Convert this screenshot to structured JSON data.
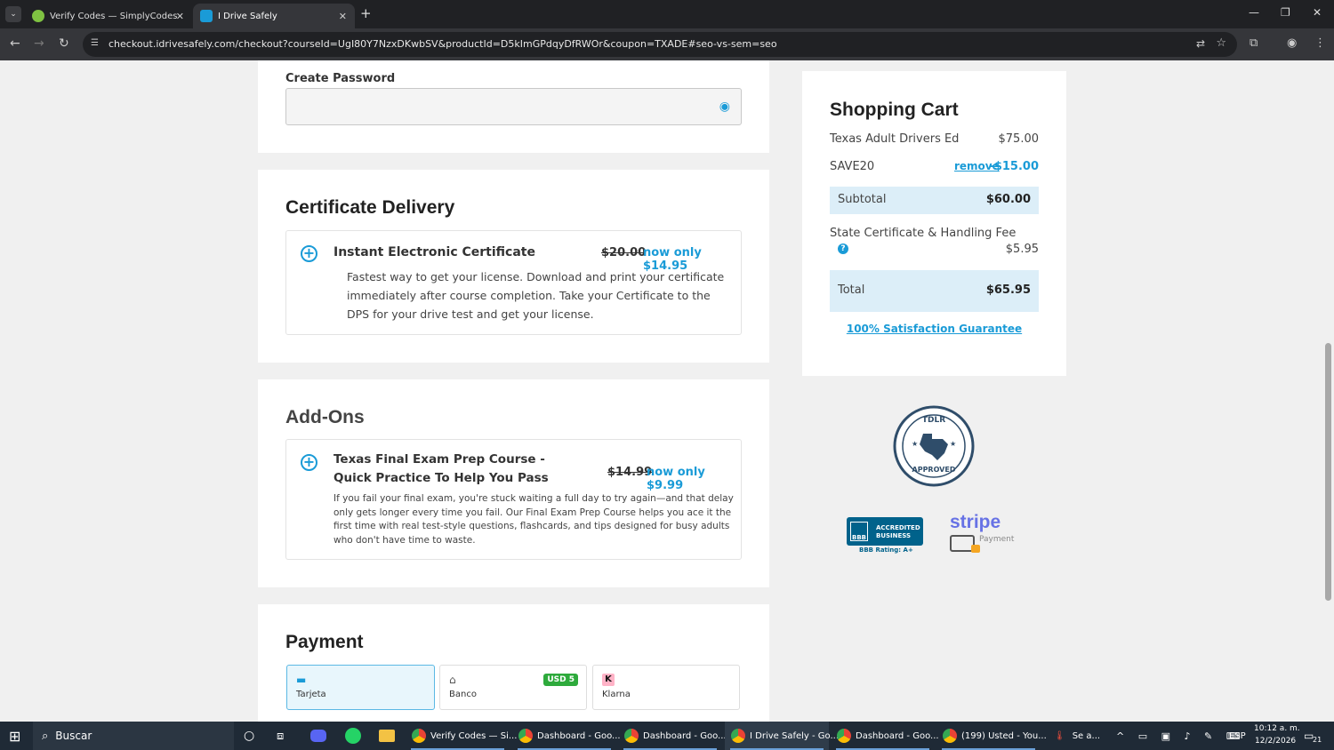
{
  "browser": {
    "tabs": [
      {
        "title": "Verify Codes — SimplyCodes",
        "icon": "check-circle-icon",
        "active": false
      },
      {
        "title": "I Drive Safely",
        "icon": "idrivesafely-icon",
        "active": true
      }
    ],
    "url": "checkout.idrivesafely.com/checkout?courseId=UgI80Y7NzxDKwbSV&productId=D5kImGPdqyDfRWOr&coupon=TXADE#seo-vs-sem=seo"
  },
  "account": {
    "password_label": "Create Password",
    "password_value": ""
  },
  "certificate": {
    "heading": "Certificate Delivery",
    "option_title": "Instant Electronic Certificate",
    "old_price": "$20.00",
    "now_price": "now only $14.95",
    "description": "Fastest way to get your license. Download and print your certificate immediately after course completion. Take your Certificate to the DPS for your drive test and get your license."
  },
  "addons": {
    "heading": "Add-Ons",
    "option_title_line1": "Texas Final Exam Prep Course -",
    "option_title_line2": "Quick Practice To Help You Pass",
    "old_price": "$14.99",
    "now_price": "now only $9.99",
    "description": "If you fail your final exam, you're stuck waiting a full day to try again—and that delay only gets longer every time you fail. Our Final Exam Prep Course helps you ace it the first time with real test-style questions, flashcards, and tips designed for busy adults who don't have time to waste."
  },
  "payment": {
    "heading": "Payment",
    "methods": [
      {
        "label": "Tarjeta",
        "icon": "card-icon",
        "selected": true
      },
      {
        "label": "Banco",
        "icon": "bank-icon",
        "badge": "USD 5",
        "selected": false
      },
      {
        "label": "Klarna",
        "icon": "klarna-icon",
        "selected": false
      }
    ]
  },
  "cart": {
    "title": "Shopping Cart",
    "item_name": "Texas Adult Drivers Ed",
    "item_price": "$75.00",
    "coupon_code": "SAVE20",
    "remove_label": "remove",
    "discount": "-$15.00",
    "subtotal_label": "Subtotal",
    "subtotal": "$60.00",
    "fee_label": "State Certificate & Handling Fee",
    "fee": "$5.95",
    "total_label": "Total",
    "total": "$65.95",
    "guarantee": "100% Satisfaction Guarantee"
  },
  "badges": {
    "tdlr_top": "TDLR",
    "tdlr_bottom": "APPROVED",
    "bbb_line1": "ACCREDITED",
    "bbb_line2": "BUSINESS",
    "bbb_rating": "BBB Rating: A+",
    "bbb_logo": "BBB",
    "stripe": "stripe",
    "stripe_sub": "Payment"
  },
  "taskbar": {
    "search": "Buscar",
    "items": [
      "Verify Codes — Si...",
      "Dashboard - Goo...",
      "Dashboard - Goo...",
      "I Drive Safely - Go...",
      "Dashboard - Goo...",
      "(199) Usted - You..."
    ],
    "weather": "Se a...",
    "lang": "ESP",
    "time": "10:12 a. m.",
    "date": "12/2/2026",
    "notifications": "21"
  },
  "colors": {
    "accent": "#1a9bd7",
    "page_bg": "#f0f0f0"
  }
}
